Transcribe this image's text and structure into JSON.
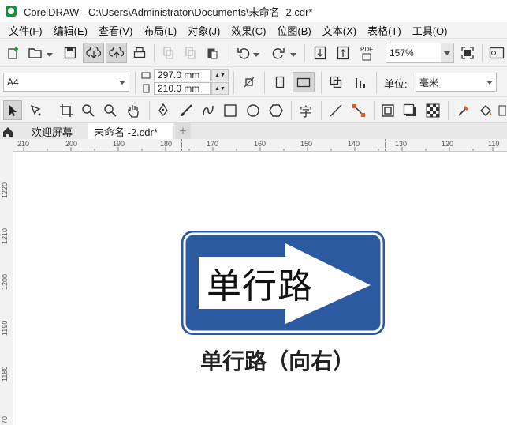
{
  "window": {
    "title": "CorelDRAW - C:\\Users\\Administrator\\Documents\\未命名 -2.cdr*"
  },
  "menu": [
    "文件(F)",
    "编辑(E)",
    "查看(V)",
    "布局(L)",
    "对象(J)",
    "效果(C)",
    "位图(B)",
    "文本(X)",
    "表格(T)",
    "工具(O)"
  ],
  "toolbar": {
    "zoom_value": "157%",
    "pdf_label": "PDF"
  },
  "property_bar": {
    "page_size": "A4",
    "width": "297.0 mm",
    "height": "210.0 mm",
    "unit_label": "单位:",
    "unit_value": "毫米"
  },
  "tools": {
    "text_tool": "字"
  },
  "tabs": {
    "welcome": "欢迎屏幕",
    "document": "未命名 -2.cdr*",
    "add": "+"
  },
  "ruler": {
    "h_ticks": [
      "210",
      "200",
      "190",
      "180",
      "170",
      "160",
      "150",
      "140",
      "130",
      "120",
      "110"
    ],
    "v_ticks": [
      "1220",
      "1210",
      "1200",
      "1190",
      "1180",
      "70"
    ]
  },
  "artwork": {
    "sign_text": "单行路",
    "caption": "单行路（向右）",
    "sign_blue": "#2c5aa0",
    "sign_white": "#ffffff"
  }
}
